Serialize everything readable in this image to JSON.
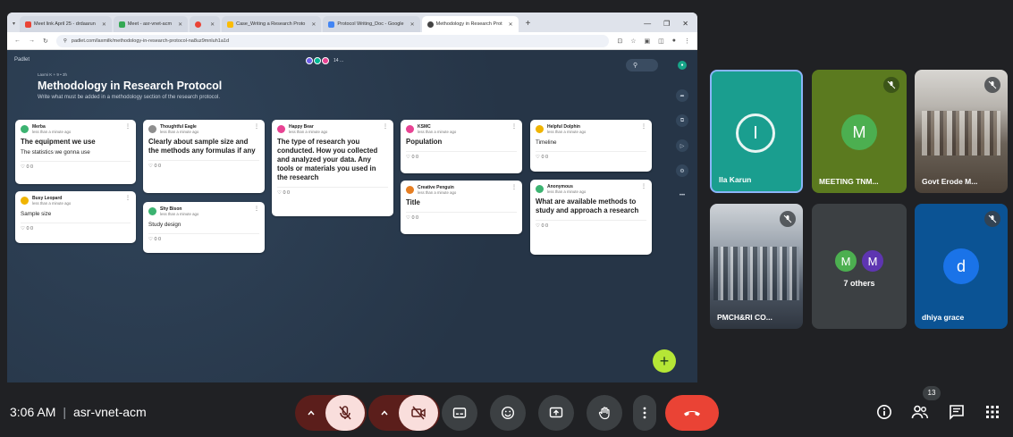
{
  "browser": {
    "tabs": [
      {
        "label": "Meet link April 25 - drdaarun"
      },
      {
        "label": "Meet - asr-vnet-acm"
      },
      {
        "label": ""
      },
      {
        "label": "Case_Writing a Research Proto"
      },
      {
        "label": "Protocol Writing_Doc - Google"
      },
      {
        "label": "Methodology in Research Prot"
      }
    ],
    "url": "padlet.com/laxmilk/methodology-in-research-protocol-na8uz9mnluh1a1d"
  },
  "padlet": {
    "brand": "Padlet",
    "author": "Laxmi K + 9 • 3h",
    "title": "Methodology in Research Protocol",
    "subtitle": "Write what must be added in a methodology section of the research protocol.",
    "online_count": "14 ...",
    "reactions": "0 0"
  },
  "cards": [
    {
      "author": "Merba",
      "time": "less than a minute ago",
      "title": "The equipment we use",
      "body": "The statistics we gonna use",
      "color": "#3cb371"
    },
    {
      "author": "Busy Leopard",
      "time": "less than a minute ago",
      "title": "",
      "body": "Sample size",
      "color": "#f0b400"
    },
    {
      "author": "Thoughtful Eagle",
      "time": "less than a minute ago",
      "title": "Clearly about sample size and the methods any formulas if any",
      "body": "",
      "color": "#8e8e8e"
    },
    {
      "author": "Shy Bison",
      "time": "less than a minute ago",
      "title": "",
      "body": "Study design",
      "color": "#3cb371"
    },
    {
      "author": "Happy Bear",
      "time": "less than a minute ago",
      "title": "The type of research you conducted. How you collected and analyzed your data. Any tools or materials you used in the research",
      "body": "",
      "color": "#e84393"
    },
    {
      "author": "KSMC",
      "time": "less than a minute ago",
      "title": "Population",
      "body": "",
      "color": "#e84393"
    },
    {
      "author": "Creative Penguin",
      "time": "less than a minute ago",
      "title": "Title",
      "body": "",
      "color": "#e67e22"
    },
    {
      "author": "Helpful Dolphin",
      "time": "less than a minute ago",
      "title": "",
      "body": "Timeline",
      "color": "#f0b400"
    },
    {
      "author": "Anonymous",
      "time": "less than a minute ago",
      "title": "What are available methods to study and approach a research",
      "body": "",
      "color": "#3cb371"
    }
  ],
  "participants": [
    {
      "name": "Ila Karun",
      "initial": "I",
      "color": "#1a9e8f"
    },
    {
      "name": "MEETING TNM...",
      "initial": "M",
      "color": "#4caf50"
    },
    {
      "name": "Govt Erode M...",
      "initial": ""
    },
    {
      "name": "PMCH&RI CO...",
      "initial": ""
    },
    {
      "name": "7 others",
      "initial": "M"
    },
    {
      "name": "dhiya grace",
      "initial": "d",
      "color": "#1a73e8"
    }
  ],
  "meeting": {
    "time": "3:06 AM",
    "code": "asr-vnet-acm",
    "people_count": "13"
  },
  "colors": {
    "end_call": "#ea4335",
    "muted_ctl": "#f9dedc",
    "muted_arrow": "#5b1e1b"
  }
}
